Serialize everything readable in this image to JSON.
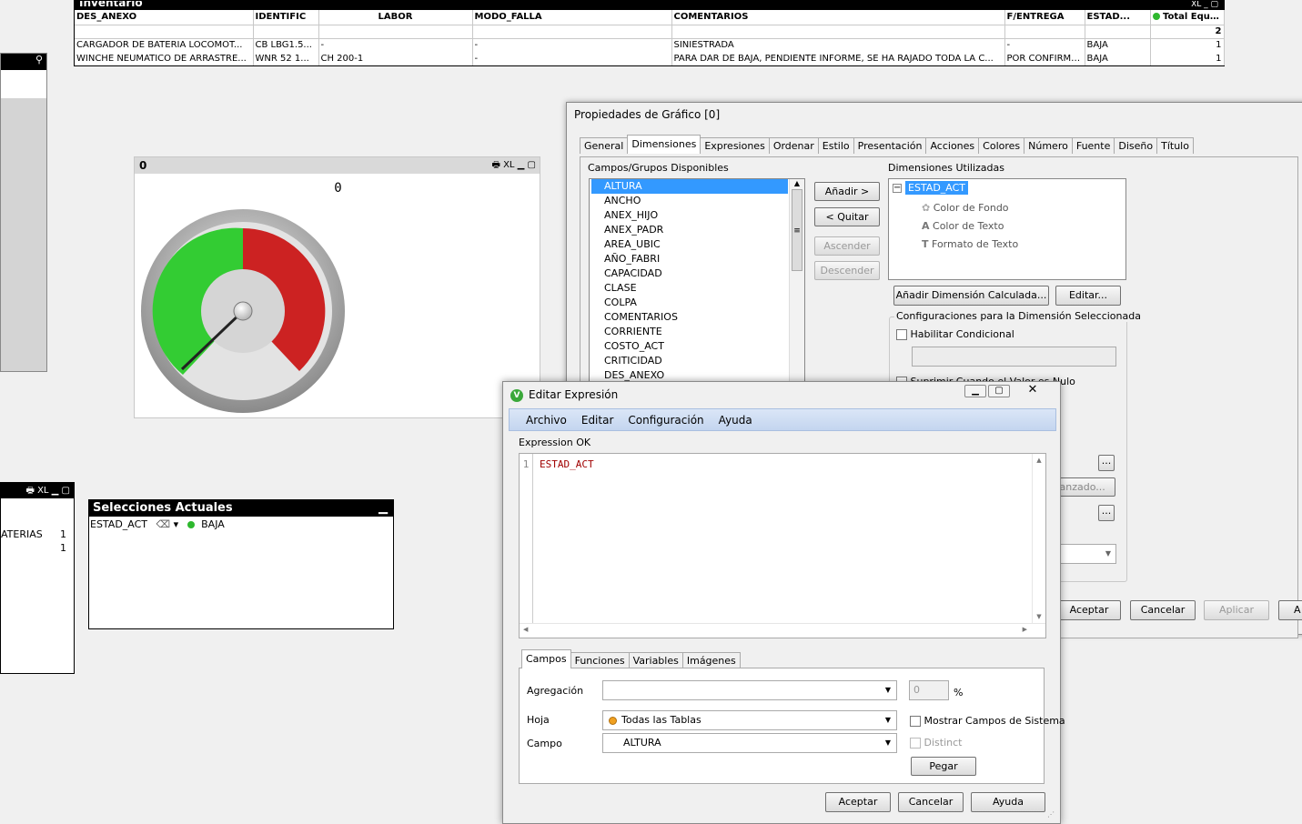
{
  "inventario": {
    "title": "Inventario",
    "icons": "XL _ ▢",
    "columns": [
      "DES_ANEXO",
      "IDENTIFIC",
      "LABOR",
      "MODO_FALLA",
      "COMENTARIOS",
      "F/ENTREGA",
      "ESTAD...",
      "Total Equipos"
    ],
    "total": "2",
    "rows": [
      [
        "CARGADOR DE BATERIA LOCOMOT...",
        "CB LBG1.5...",
        "-",
        "-",
        "SINIESTRADA",
        "-",
        "BAJA",
        "1"
      ],
      [
        "WINCHE NEUMATICO DE ARRASTRE...",
        "WNR 52 1...",
        "CH 200-1",
        "-",
        "PARA DAR DE BAJA, PENDIENTE INFORME, SE HA RAJADO TODA LA C...",
        "POR CONFIRMAR",
        "BAJA",
        "1"
      ]
    ]
  },
  "gauge": {
    "caption": "0",
    "value_label": "0",
    "icons": "XL",
    "chart_data": {
      "type": "gauge",
      "value": 0,
      "segments": [
        {
          "color": "#33cc33"
        },
        {
          "color": "#cc2222"
        }
      ]
    }
  },
  "listbox2": {
    "icons": "XL",
    "rows": [
      {
        "label": "ATERIAS",
        "count": "1"
      },
      {
        "label": "",
        "count": "1"
      }
    ]
  },
  "selecciones": {
    "title": "Selecciones Actuales",
    "field": "ESTAD_ACT",
    "value": "BAJA"
  },
  "props": {
    "title": "Propiedades de Gráfico [0]",
    "tabs": [
      "General",
      "Dimensiones",
      "Expresiones",
      "Ordenar",
      "Estilo",
      "Presentación",
      "Acciones",
      "Colores",
      "Número",
      "Fuente",
      "Diseño",
      "Título"
    ],
    "available_label": "Campos/Grupos Disponibles",
    "fields": [
      "ALTURA",
      "ANCHO",
      "ANEX_HIJO",
      "ANEX_PADR",
      "AREA_UBIC",
      "AÑO_FABRI",
      "CAPACIDAD",
      "CLASE",
      "COLPA",
      "COMENTARIOS",
      "CORRIENTE",
      "COSTO_ACT",
      "CRITICIDAD",
      "DES_ANEXO"
    ],
    "buttons": {
      "add": "Añadir >",
      "remove": "< Quitar",
      "up": "Ascender",
      "down": "Descender"
    },
    "used_label": "Dimensiones Utilizadas",
    "used_dim": "ESTAD_ACT",
    "used_children": [
      "Color de Fondo",
      "Color de Texto",
      "Formato de Texto"
    ],
    "calc_button": "Añadir Dimensión Calculada...",
    "edit_button": "Editar...",
    "config_label": "Configuraciones para la Dimensión Seleccionada",
    "conditional_label": "Habilitar Condicional",
    "suppress_label": "Suprimir Cuando el Valor es Nulo",
    "advanced_button": "Avanzado...",
    "ok": "Aceptar",
    "cancel": "Cancelar",
    "apply": "Aplicar"
  },
  "expr": {
    "title": "Editar Expresión",
    "menu": [
      "Archivo",
      "Editar",
      "Configuración",
      "Ayuda"
    ],
    "status": "Expression OK",
    "line_no": "1",
    "code": "ESTAD_ACT",
    "tabs": [
      "Campos",
      "Funciones",
      "Variables",
      "Imágenes"
    ],
    "aggregation_label": "Agregación",
    "aggregation_value": "",
    "percent_value": "0",
    "percent_sign": "%",
    "sheet_label": "Hoja",
    "sheet_value": "Todas las Tablas",
    "field_label": "Campo",
    "field_value": "ALTURA",
    "system_fields_label": "Mostrar Campos de Sistema",
    "distinct_label": "Distinct",
    "paste_button": "Pegar",
    "ok": "Aceptar",
    "cancel": "Cancelar",
    "help": "Ayuda"
  }
}
